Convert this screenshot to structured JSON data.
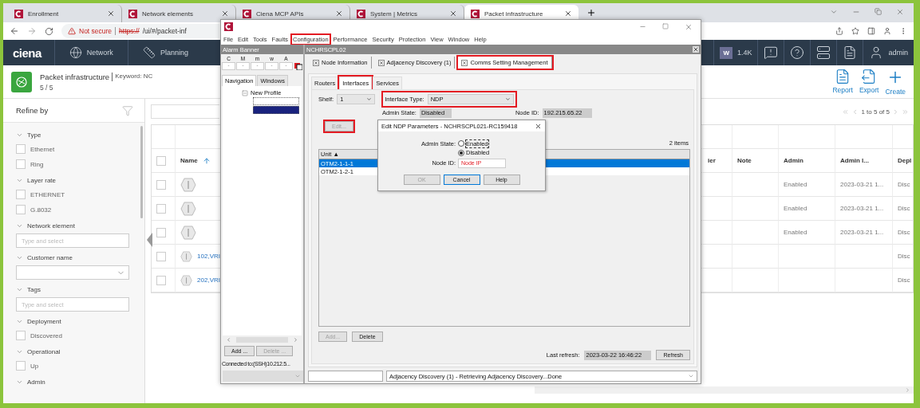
{
  "browser": {
    "tabs": [
      {
        "title": "Enrollment",
        "selected": false
      },
      {
        "title": "Network elements",
        "selected": false
      },
      {
        "title": "Ciena MCP APIs",
        "selected": false
      },
      {
        "title": "System | Metrics",
        "selected": false
      },
      {
        "title": "Packet infrastructure",
        "selected": true
      }
    ],
    "address": {
      "warning": "Not secure",
      "scheme": "https://",
      "path": "/ui/#/packet-inf"
    }
  },
  "nav": {
    "logo": "ciena",
    "items": [
      {
        "label": "Network",
        "kind": "network"
      },
      {
        "label": "Planning",
        "kind": "planning"
      }
    ],
    "badge": "W",
    "badge_count": "1.4K",
    "user": "admin"
  },
  "header": {
    "title": "Packet infrastructure",
    "keyword": "Keyword: NC",
    "count": "5 / 5",
    "actions": [
      {
        "label": "Report",
        "kind": "report"
      },
      {
        "label": "Export",
        "kind": "export"
      },
      {
        "label": "Create",
        "kind": "create"
      }
    ]
  },
  "filters": {
    "title": "Refine by",
    "groups": [
      {
        "label": "Type",
        "kind": "checkboxes",
        "options": [
          {
            "label": "Ethernet",
            "checked": false
          },
          {
            "label": "Ring",
            "checked": false
          }
        ]
      },
      {
        "label": "Layer rate",
        "kind": "checkboxes",
        "options": [
          {
            "label": "ETHERNET",
            "checked": false
          },
          {
            "label": "G.8032",
            "checked": false
          }
        ]
      },
      {
        "label": "Network element",
        "kind": "input",
        "placeholder": "Type and select"
      },
      {
        "label": "Customer name",
        "kind": "select"
      },
      {
        "label": "Tags",
        "kind": "input",
        "placeholder": "Type and select"
      },
      {
        "label": "Deployment",
        "kind": "checkboxes",
        "options": [
          {
            "label": "Discovered",
            "checked": false
          }
        ]
      },
      {
        "label": "Operational",
        "kind": "checkboxes",
        "options": [
          {
            "label": "Up",
            "checked": false
          }
        ]
      },
      {
        "label": "Admin",
        "kind": "checkboxes"
      }
    ]
  },
  "table": {
    "pagination": "1 to 5 of 5",
    "all_checked": false,
    "columns": [
      {
        "label": "Name",
        "sorted": true
      },
      {
        "label": "ier"
      },
      {
        "label": "Note"
      },
      {
        "label": "Admin"
      },
      {
        "label": "Admin l..."
      },
      {
        "label": "Depl"
      }
    ],
    "rows": [
      {
        "checked": false,
        "admin": "Enabled",
        "admin_l": "2023-03-21 1...",
        "depl": "Disc"
      },
      {
        "checked": false,
        "admin": "Enabled",
        "admin_l": "2023-03-21 1...",
        "depl": "Disc"
      },
      {
        "checked": false,
        "admin": "Enabled",
        "admin_l": "2023-03-21 1...",
        "depl": "Disc"
      },
      {
        "checked": false,
        "name": "102,VRI",
        "depl": "Disc"
      },
      {
        "checked": false,
        "name": "202,VRI",
        "depl": "Disc"
      }
    ]
  },
  "app_window": {
    "menu": [
      {
        "label": "File",
        "highlighted": false
      },
      {
        "label": "Edit",
        "highlighted": false
      },
      {
        "label": "Tools",
        "highlighted": false
      },
      {
        "label": "Faults",
        "highlighted": false
      },
      {
        "label": "Configuration",
        "highlighted": true
      },
      {
        "label": "Performance",
        "highlighted": false
      },
      {
        "label": "Security",
        "highlighted": false
      },
      {
        "label": "Protection",
        "highlighted": false
      },
      {
        "label": "View",
        "highlighted": false
      },
      {
        "label": "Window",
        "highlighted": false
      },
      {
        "label": "Help",
        "highlighted": false
      }
    ],
    "alarm_banner": {
      "title": "Alarm Banner",
      "columns": [
        "C",
        "M",
        "m",
        "w",
        "A"
      ],
      "values": [
        "-",
        "-",
        "-",
        "-",
        "-"
      ]
    },
    "nav_tabs": [
      {
        "label": "Navigation",
        "selected": true
      },
      {
        "label": "Windows",
        "selected": false
      }
    ],
    "tree": {
      "label": "New Profile",
      "expanded": true,
      "children": [
        {
          "selected": false
        },
        {
          "selected": true
        }
      ]
    },
    "nav_buttons": [
      {
        "label": "Add ...",
        "disabled": false
      },
      {
        "label": "Delete ...",
        "disabled": true
      }
    ],
    "connection": "Connected to:(SSH)10.212.5...",
    "frame_title": "NCHRSCPL02",
    "tabs": [
      {
        "label": "Node Information",
        "selected": false,
        "highlighted": false
      },
      {
        "label": "Adjacency Discovery (1)",
        "selected": false,
        "highlighted": false
      },
      {
        "label": "Comms Setting Management",
        "selected": true,
        "highlighted": true
      }
    ],
    "subtabs": [
      {
        "label": "Routers",
        "selected": false,
        "highlighted": false
      },
      {
        "label": "Interfaces",
        "selected": true,
        "highlighted": true
      },
      {
        "label": "Services",
        "selected": false,
        "highlighted": false
      }
    ],
    "shelf": {
      "label": "Shelf:",
      "value": "1"
    },
    "interface_type": {
      "label": "Interface Type:",
      "value": "NDP",
      "highlighted": true
    },
    "admin_state": {
      "label": "Admin State:",
      "value": "Disabled"
    },
    "node_id": {
      "label": "Node ID:",
      "value": "192.215.65.22"
    },
    "edit_button": {
      "label": "Edit...",
      "disabled": true,
      "highlighted": true
    },
    "item_count": "2 items",
    "unit_column": "Unit ▲",
    "units": [
      {
        "label": "OTM2-1-1-1",
        "selected": true
      },
      {
        "label": "OTM2-1-2-1",
        "selected": false
      }
    ],
    "list_buttons": [
      {
        "label": "Add...",
        "disabled": true
      },
      {
        "label": "Delete",
        "disabled": false
      }
    ],
    "last_refresh": {
      "label": "Last refresh:",
      "value": "2023-03-22 16:46:22"
    },
    "refresh_button": "Refresh",
    "status": "Adjacency Discovery (1) - Retrieving Adjacency Discovery...Done",
    "dialog": {
      "title": "Edit NDP Parameters - NCHRSCPL021-RC159418",
      "admin_label": "Admin State:",
      "options": [
        {
          "label": "Enabled",
          "selected": false,
          "focused": true
        },
        {
          "label": "Disabled",
          "selected": true,
          "focused": false
        }
      ],
      "node_label": "Node ID:",
      "node_value": "Node IP",
      "buttons": [
        {
          "label": "OK",
          "disabled": true,
          "focused": false
        },
        {
          "label": "Cancel",
          "disabled": false,
          "focused": true
        },
        {
          "label": "Help",
          "disabled": false,
          "focused": false
        }
      ]
    }
  }
}
